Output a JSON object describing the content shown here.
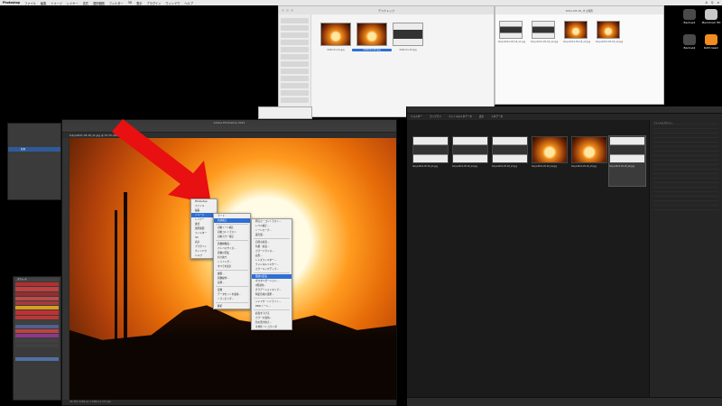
{
  "menubar": {
    "app": "Photoshop",
    "items": [
      "ファイル",
      "編集",
      "イメージ",
      "レイヤー",
      "書式",
      "選択範囲",
      "フィルター",
      "3D",
      "表示",
      "プラグイン",
      "ウィンドウ",
      "ヘルプ"
    ],
    "right": [
      "A",
      "Q",
      "≡"
    ]
  },
  "finder": {
    "title": "デスクトップ",
    "thumbs": [
      {
        "label": "2020-01-01.jpg",
        "selected": false
      },
      {
        "label": "2020-01-02.jpg",
        "selected": true
      },
      {
        "label": "2020-01-03.jpg",
        "selected": false
      }
    ]
  },
  "finder2": {
    "title": "2021-08-18_ネコ撮影",
    "files": [
      "tokyo2021-05-18_a1.jpg",
      "tokyo2021-05-18_a2.jpg",
      "tokyo2021-05-18_a3.jpg",
      "tokyo2021-05-18_a4.jpg"
    ]
  },
  "desktop": [
    {
      "label": "Backup1",
      "color": "#4a4a4a"
    },
    {
      "label": "Macintosh HD",
      "color": "#c8c8c8"
    },
    {
      "label": "Backup2",
      "color": "#4a4a4a"
    },
    {
      "label": "DATA team",
      "color": "#f08d1f"
    }
  ],
  "photoshop": {
    "title": "Adobe Photoshop 2021",
    "tab": "tokyo2021-05-18_a1.jpg @ 33.3% (RGB/8)",
    "status": "33.33%   5184 px x 3456 px (72 ppi)"
  },
  "layers_panel": {
    "layer_name": "背景"
  },
  "swatches": [
    {
      "label": "スウォッチ",
      "color": "#444"
    },
    {
      "label": "",
      "color": "#b03030"
    },
    {
      "label": "",
      "color": "#c04040"
    },
    {
      "label": "",
      "color": "#903030"
    },
    {
      "label": "",
      "color": "#c04a4a"
    },
    {
      "label": "",
      "color": "#a83a3a"
    },
    {
      "label": "",
      "color": "#d4a020"
    },
    {
      "label": "",
      "color": "#c03030"
    },
    {
      "label": "",
      "color": "#b83838"
    },
    {
      "label": "",
      "color": "#404040"
    },
    {
      "label": "",
      "color": "#506090"
    },
    {
      "label": "",
      "color": "#c04040"
    },
    {
      "label": "",
      "color": "#8a3a8a"
    },
    {
      "label": "",
      "color": "#404040"
    },
    {
      "label": "",
      "color": "#404040"
    },
    {
      "label": "",
      "color": "#3a3a3a"
    },
    {
      "label": "",
      "color": "#3a3a3a"
    },
    {
      "label": "",
      "color": "#5070a0"
    },
    {
      "label": "",
      "color": "#3a3a3a"
    },
    {
      "label": "",
      "color": "#3a3a3a"
    },
    {
      "label": "",
      "color": "#3a3a3a"
    }
  ],
  "menu1": [
    "Photoshop",
    "ファイル",
    "編集",
    "イメージ",
    "レイヤー",
    "書式",
    "選択範囲",
    "フィルター",
    "3D",
    "表示",
    "プラグイン",
    "ウィンドウ",
    "ヘルプ"
  ],
  "menu2": [
    "モード",
    "色調補正",
    "自動トーン補正",
    "自動コントラスト",
    "自動カラー補正",
    "画像解像度...",
    "カンバスサイズ...",
    "画像の回転",
    "切り抜き",
    "トリミング...",
    "すべてを表示",
    "複製...",
    "画像操作...",
    "演算...",
    "変数",
    "データセットを適用...",
    "トラッピング...",
    "解析"
  ],
  "menu3": [
    "明るさ・コントラスト...",
    "レベル補正...",
    "トーンカーブ...",
    "露光量...",
    "自然な彩度...",
    "色相・彩度...",
    "カラーバランス...",
    "白黒...",
    "レンズフィルター...",
    "チャンネルミキサー...",
    "カラールックアップ...",
    "階調の反転",
    "ポスタリゼーション...",
    "2階調化...",
    "グラデーションマップ...",
    "特定色域の選択...",
    "シャドウ・ハイライト...",
    "HDR トーン...",
    "彩度を下げる",
    "カラーの適用...",
    "色の置き換え...",
    "平均化（イコライズ）"
  ],
  "menu3_highlight": 12,
  "bridge": {
    "path": [
      "フォルダー",
      "ライブラリ",
      "ファイルのメタデータ",
      "表示",
      "メタデータ"
    ],
    "cells": [
      {
        "cap": "tokyo2021-05-18_a1.jpg",
        "kind": "screen"
      },
      {
        "cap": "tokyo2021-05-18_a2.jpg",
        "kind": "screen"
      },
      {
        "cap": "tokyo2021-05-18_a3.jpg",
        "kind": "screen"
      },
      {
        "cap": "tokyo2021-05-18_a4.jpg",
        "kind": "sunset"
      },
      {
        "cap": "tokyo2021-05-18_a5.jpg",
        "kind": "sunset"
      },
      {
        "cap": "tokyo2021-05-18_a6.jpg",
        "kind": "screen"
      }
    ],
    "meta_title": "ファイルのプロパティ"
  }
}
